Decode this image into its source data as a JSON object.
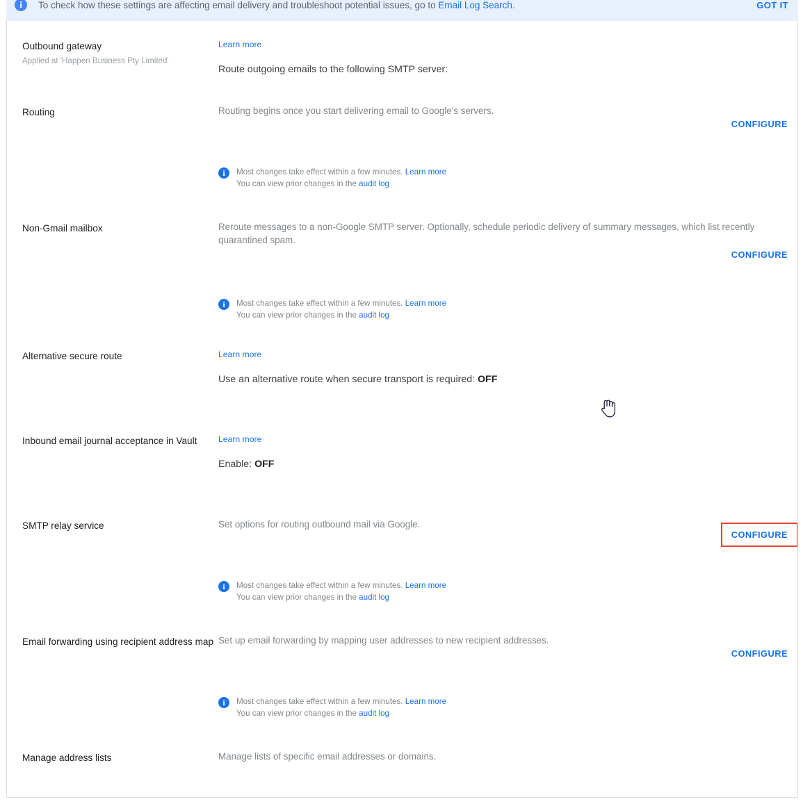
{
  "banner": {
    "icon": "info-icon",
    "text_before": "To check how these settings are affecting email delivery and troubleshoot potential issues, go to ",
    "link": "Email Log Search",
    "text_after": ".",
    "action": "GOT IT"
  },
  "labels": {
    "configure": "CONFIGURE",
    "learn_more": "Learn more",
    "note_line1_prefix": "Most changes take effect within a few minutes. ",
    "note_line1_link": "Learn more",
    "note_line2_prefix": "You can view prior changes in the ",
    "note_line2_link": "audit log"
  },
  "colors": {
    "accent": "#1a73e8",
    "banner_bg": "#e8f0fe",
    "highlight": "#ea4335",
    "muted": "#80868b"
  },
  "sections": [
    {
      "title": "Outbound gateway",
      "subtitle": "Applied at 'Happen Business Pty Limited'",
      "learn_more": "Learn more",
      "statement": "Route outgoing emails to the following SMTP server:"
    },
    {
      "title": "Routing",
      "description": "Routing begins once you start delivering email to Google's servers.",
      "configure": "CONFIGURE"
    },
    {
      "title": "Non-Gmail mailbox",
      "description": "Reroute messages to a non-Google SMTP server. Optionally, schedule periodic delivery of summary messages, which list recently quarantined spam.",
      "configure": "CONFIGURE"
    },
    {
      "title": "Alternative secure route",
      "learn_more": "Learn more",
      "statement_prefix": "Use an alternative route when secure transport is required: ",
      "statement_value": "OFF"
    },
    {
      "title": "Inbound email journal acceptance in Vault",
      "learn_more": "Learn more",
      "statement_prefix": "Enable: ",
      "statement_value": "OFF"
    },
    {
      "title": "SMTP relay service",
      "description": "Set options for routing outbound mail via Google.",
      "configure": "CONFIGURE"
    },
    {
      "title": "Email forwarding using recipient address map",
      "description": "Set up email forwarding by mapping user addresses to new recipient addresses.",
      "configure": "CONFIGURE"
    },
    {
      "title": "Manage address lists",
      "description": "Manage lists of specific email addresses or domains."
    }
  ]
}
